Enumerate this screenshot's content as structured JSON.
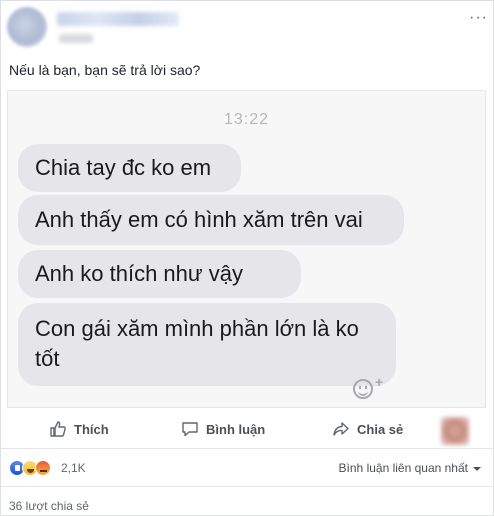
{
  "post": {
    "caption": "Nếu là bạn, bạn sẽ trả lời sao?",
    "more_icon": "ellipsis-icon"
  },
  "screenshot": {
    "time": "13:22",
    "messages": [
      "Chia tay đc ko em",
      "Anh thấy em có hình xăm trên vai",
      "Anh ko thích như vậy",
      "Con gái xăm mình phần lớn là ko tốt"
    ]
  },
  "actions": {
    "like_label": "Thích",
    "comment_label": "Bình luận",
    "share_label": "Chia sẻ"
  },
  "reactions": {
    "count": "2,1K",
    "types": [
      "like",
      "haha",
      "angry"
    ],
    "sort_label": "Bình luận liên quan nhất"
  },
  "shares": {
    "label": "36 lượt chia sẻ"
  },
  "colors": {
    "bubble": "#e6e6ea",
    "action_text": "#4b4f56",
    "like_blue": "#1b55d0"
  }
}
